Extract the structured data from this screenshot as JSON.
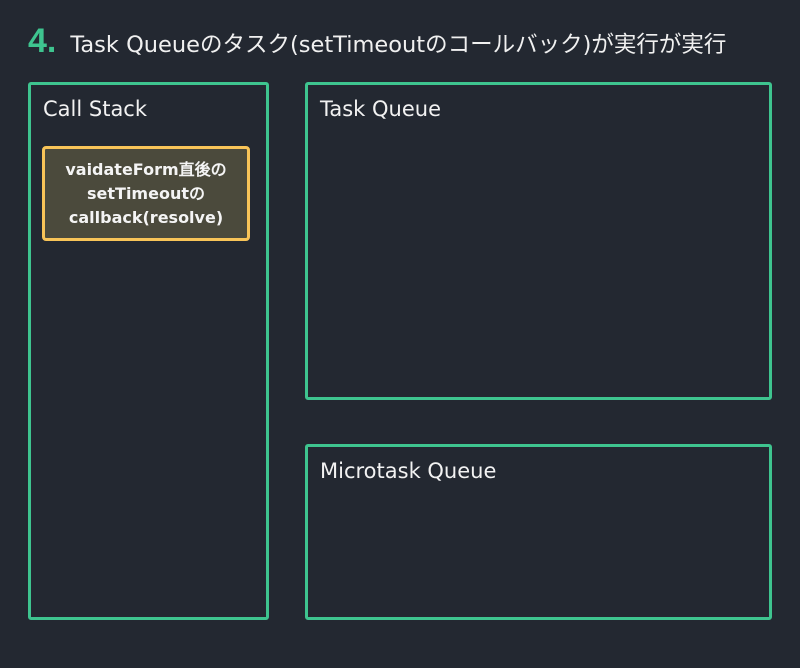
{
  "header": {
    "step_number": "4.",
    "title": "Task Queueのタスク(setTimeoutのコールバック)が実行が実行"
  },
  "call_stack": {
    "label": "Call Stack",
    "frames": [
      {
        "lines": [
          "vaidateForm直後の",
          "setTimeoutの",
          "callback(resolve)"
        ]
      }
    ]
  },
  "task_queue": {
    "label": "Task Queue"
  },
  "microtask_queue": {
    "label": "Microtask Queue"
  },
  "colors": {
    "background": "#232831",
    "panel_border": "#3ec48f",
    "frame_border": "#f8c458",
    "frame_fill": "#4b4a3c",
    "text": "#f2f2f2"
  }
}
